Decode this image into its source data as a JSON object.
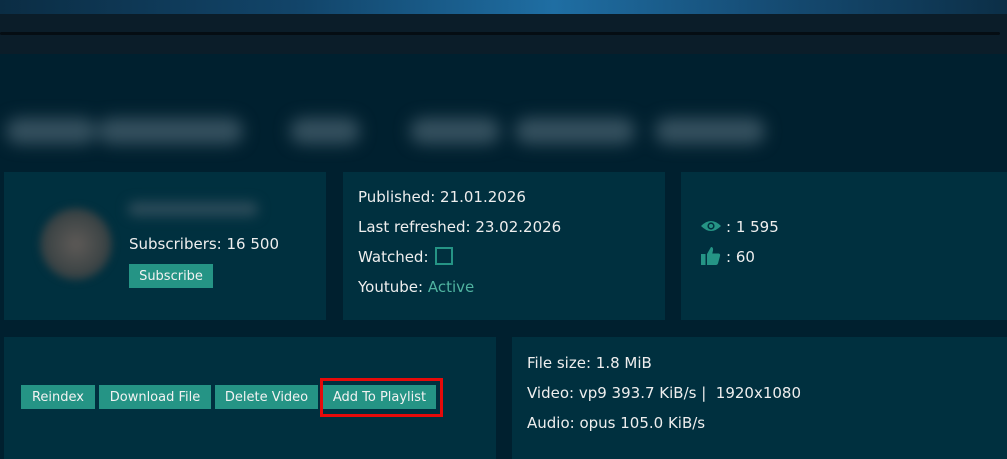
{
  "channel": {
    "subscribers_label": "Subscribers: 16 500",
    "subscribe_label": "Subscribe"
  },
  "meta": {
    "published": "Published: 21.01.2026",
    "last_refreshed": "Last refreshed: 23.02.2026",
    "watched_label": "Watched:",
    "youtube_label": "Youtube:",
    "youtube_status": "Active"
  },
  "stats": {
    "views": ": 1 595",
    "likes": ": 60"
  },
  "actions": {
    "reindex": "Reindex",
    "download": "Download File",
    "delete": "Delete Video",
    "add_playlist": "Add To Playlist"
  },
  "file_info": {
    "size": "File size: 1.8 MiB",
    "video": "Video: vp9 393.7 KiB/s |  1920x1080",
    "audio": "Audio: opus 105.0 KiB/s"
  },
  "colors": {
    "accent": "#259485",
    "highlight": "#e60a0a",
    "card": "#00303f",
    "background": "#00202f"
  },
  "icons": {
    "views": "eye-icon",
    "likes": "thumbs-up-icon"
  }
}
